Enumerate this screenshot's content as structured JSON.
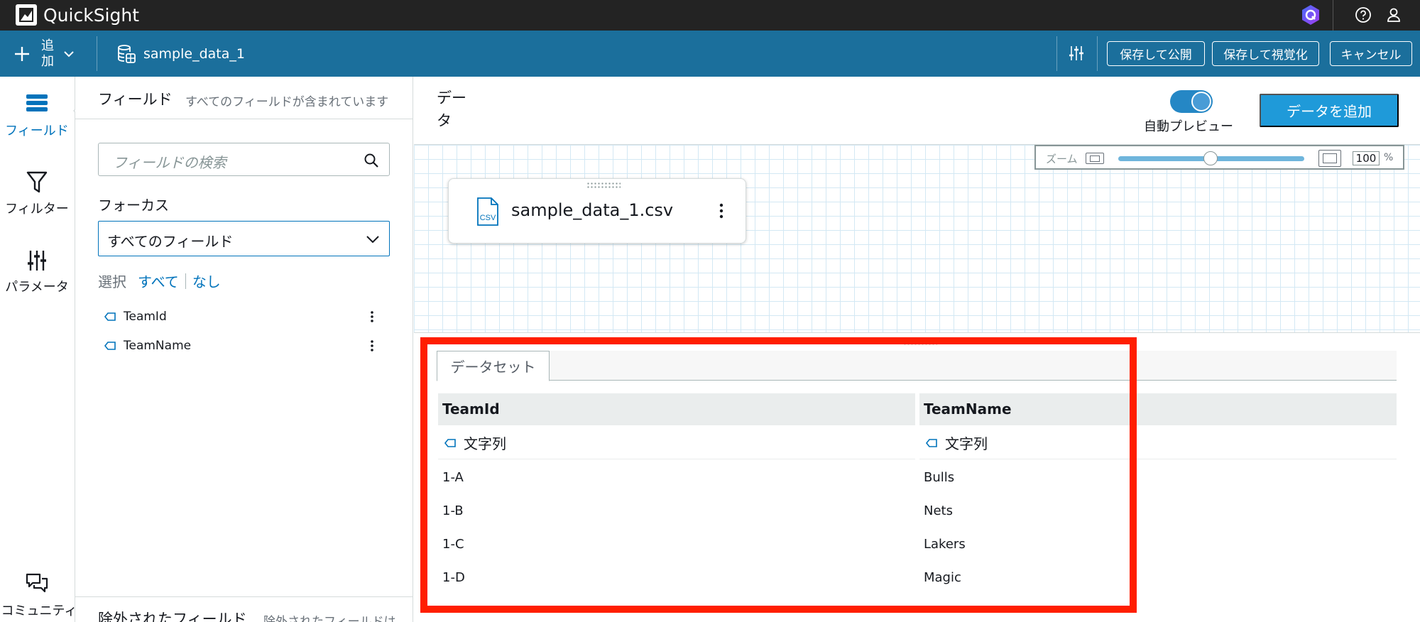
{
  "app": {
    "title": "QuickSight"
  },
  "toolbar": {
    "add_label": "追加",
    "dataset_name": "sample_data_1",
    "save_publish": "保存して公開",
    "save_visualize": "保存して視覚化",
    "cancel": "キャンセル"
  },
  "rail": {
    "fields": "フィールド",
    "filter": "フィルター",
    "parameters": "パラメータ",
    "community": "コミュニティ"
  },
  "fields_panel": {
    "title": "フィールド",
    "subtitle": "すべてのフィールドが含まれています",
    "search_placeholder": "フィールドの検索",
    "focus_label": "フォーカス",
    "focus_value": "すべてのフィールド",
    "select_label": "選択",
    "select_all": "すべて",
    "select_none": "なし",
    "fields": [
      {
        "name": "TeamId"
      },
      {
        "name": "TeamName"
      }
    ],
    "excluded_title": "除外されたフィールド",
    "excluded_subtitle": "除外されたフィールドは"
  },
  "data_area": {
    "title": "データ",
    "auto_preview_label": "自動プレビュー",
    "auto_preview_on": true,
    "add_data_button": "データを追加",
    "zoom_label": "ズーム",
    "zoom_value": "100",
    "zoom_unit": "%",
    "source_node": {
      "name": "sample_data_1.csv",
      "icon_text": "CSV"
    }
  },
  "dataset_grid": {
    "tab": "データセット",
    "columns": [
      {
        "header": "TeamId",
        "type": "文字列"
      },
      {
        "header": "TeamName",
        "type": "文字列"
      }
    ],
    "rows": [
      [
        "1-A",
        "Bulls"
      ],
      [
        "1-B",
        "Nets"
      ],
      [
        "1-C",
        "Lakers"
      ],
      [
        "1-D",
        "Magic"
      ]
    ]
  },
  "colors": {
    "topbar": "#232323",
    "toolbar": "#1b6f9c",
    "accent": "#0073bb",
    "add_data_button": "#1f9ad9",
    "highlight_box": "#ff1e00"
  }
}
